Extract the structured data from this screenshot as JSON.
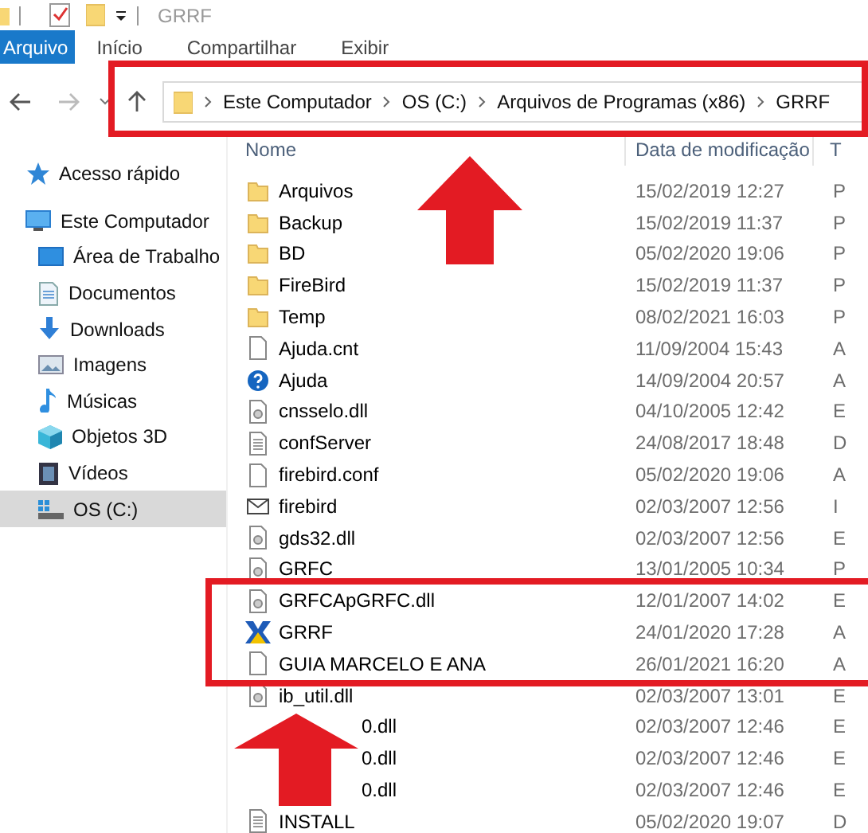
{
  "window": {
    "title": "GRRF"
  },
  "ribbon_tabs": [
    {
      "label": "Arquivo",
      "selected": true
    },
    {
      "label": "Início",
      "selected": false
    },
    {
      "label": "Compartilhar",
      "selected": false
    },
    {
      "label": "Exibir",
      "selected": false
    }
  ],
  "address_bar": {
    "path": [
      "Este Computador",
      "OS (C:)",
      "Arquivos de Programas (x86)",
      "GRRF"
    ]
  },
  "sidebar": {
    "items": [
      {
        "label": "Acesso rápido",
        "kind": "star",
        "selected": false
      },
      {
        "label": "Este Computador",
        "kind": "computer",
        "selected": false,
        "children": [
          {
            "label": "Área de Trabalho",
            "kind": "desktop",
            "selected": false
          },
          {
            "label": "Documentos",
            "kind": "documents",
            "selected": false
          },
          {
            "label": "Downloads",
            "kind": "download",
            "selected": false
          },
          {
            "label": "Imagens",
            "kind": "pictures",
            "selected": false
          },
          {
            "label": "Músicas",
            "kind": "music",
            "selected": false
          },
          {
            "label": "Objetos 3D",
            "kind": "cube",
            "selected": false
          },
          {
            "label": "Vídeos",
            "kind": "video",
            "selected": false
          },
          {
            "label": "OS (C:)",
            "kind": "drive",
            "selected": true
          }
        ]
      }
    ]
  },
  "file_list": {
    "columns": [
      "Nome",
      "Data de modificação",
      "T"
    ],
    "rows": [
      {
        "name": "Arquivos",
        "kind": "folder",
        "modified": "15/02/2019 12:27",
        "column_3": "P"
      },
      {
        "name": "Backup",
        "kind": "folder",
        "modified": "15/02/2019 11:37",
        "column_3": "P"
      },
      {
        "name": "BD",
        "kind": "folder",
        "modified": "05/02/2020 19:06",
        "column_3": "P"
      },
      {
        "name": "FireBird",
        "kind": "folder",
        "modified": "15/02/2019 11:37",
        "column_3": "P"
      },
      {
        "name": "Temp",
        "kind": "folder",
        "modified": "08/02/2021 16:03",
        "column_3": "P"
      },
      {
        "name": "Ajuda.cnt",
        "kind": "file",
        "modified": "11/09/2004 15:43",
        "column_3": "A"
      },
      {
        "name": "Ajuda",
        "kind": "help",
        "modified": "14/09/2004 20:57",
        "column_3": "A"
      },
      {
        "name": "cnsselo.dll",
        "kind": "dll",
        "modified": "04/10/2005 12:42",
        "column_3": "E"
      },
      {
        "name": "confServer",
        "kind": "document",
        "modified": "24/08/2017 18:48",
        "column_3": "D"
      },
      {
        "name": "firebird.conf",
        "kind": "file",
        "modified": "05/02/2020 19:06",
        "column_3": "A"
      },
      {
        "name": "firebird",
        "kind": "mail",
        "modified": "02/03/2007 12:56",
        "column_3": "I"
      },
      {
        "name": "gds32.dll",
        "kind": "dll",
        "modified": "02/03/2007 12:56",
        "column_3": "E"
      },
      {
        "name": "GRFC",
        "kind": "dll",
        "modified": "13/01/2005 10:34",
        "column_3": "P"
      },
      {
        "name": "GRFCApGRFC.dll",
        "kind": "dll",
        "modified": "12/01/2007 14:02",
        "column_3": "E"
      },
      {
        "name": "GRRF",
        "kind": "app",
        "modified": "24/01/2020 17:28",
        "column_3": "A"
      },
      {
        "name": "GUIA MARCELO E ANA",
        "kind": "file",
        "modified": "26/01/2021 16:20",
        "column_3": "A"
      },
      {
        "name": "ib_util.dll",
        "kind": "dll",
        "modified": "02/03/2007 13:01",
        "column_3": "E"
      },
      {
        "name": "0.dll",
        "covered": true,
        "modified": "02/03/2007 12:46",
        "column_3": "E"
      },
      {
        "name": "0.dll",
        "covered": true,
        "modified": "02/03/2007 12:46",
        "column_3": "E"
      },
      {
        "name": "0.dll",
        "covered": true,
        "modified": "02/03/2007 12:46",
        "column_3": "E"
      },
      {
        "name": "INSTALL",
        "kind": "document",
        "modified": "05/02/2020 19:07",
        "column_3": "D"
      }
    ]
  }
}
